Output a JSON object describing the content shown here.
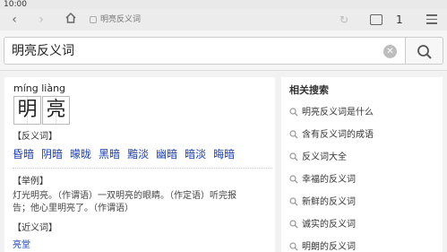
{
  "status": {
    "time": "10:00"
  },
  "browser": {
    "url_text": "明亮反义词",
    "tab_count": "1"
  },
  "search": {
    "query": "明亮反义词"
  },
  "entry": {
    "pinyin": "míng liàng",
    "chars": [
      "明",
      "亮"
    ],
    "antonym_title": "【反义词】",
    "antonyms": [
      "昏暗",
      "阴暗",
      "曚昽",
      "黑暗",
      "黯淡",
      "幽暗",
      "暗淡",
      "晦暗"
    ],
    "example_title": "【举例】",
    "example_line1": "灯光明亮。（作谓语）一双明亮的眼睛。（作定语）听完报",
    "example_line2": "告；他心里明亮了。（作谓语）",
    "synonym_title": "【近义词】",
    "synonym_first": "亮堂"
  },
  "related": {
    "title": "相关搜索",
    "items": [
      "明亮反义词是什么",
      "含有反义词的成语",
      "反义词大全",
      "幸福的反义词",
      "新鲜的反义词",
      "诚实的反义词",
      "明朗的反义词"
    ]
  },
  "colors": {
    "link": "#1a3fb0",
    "background": "#f2f2f2"
  }
}
